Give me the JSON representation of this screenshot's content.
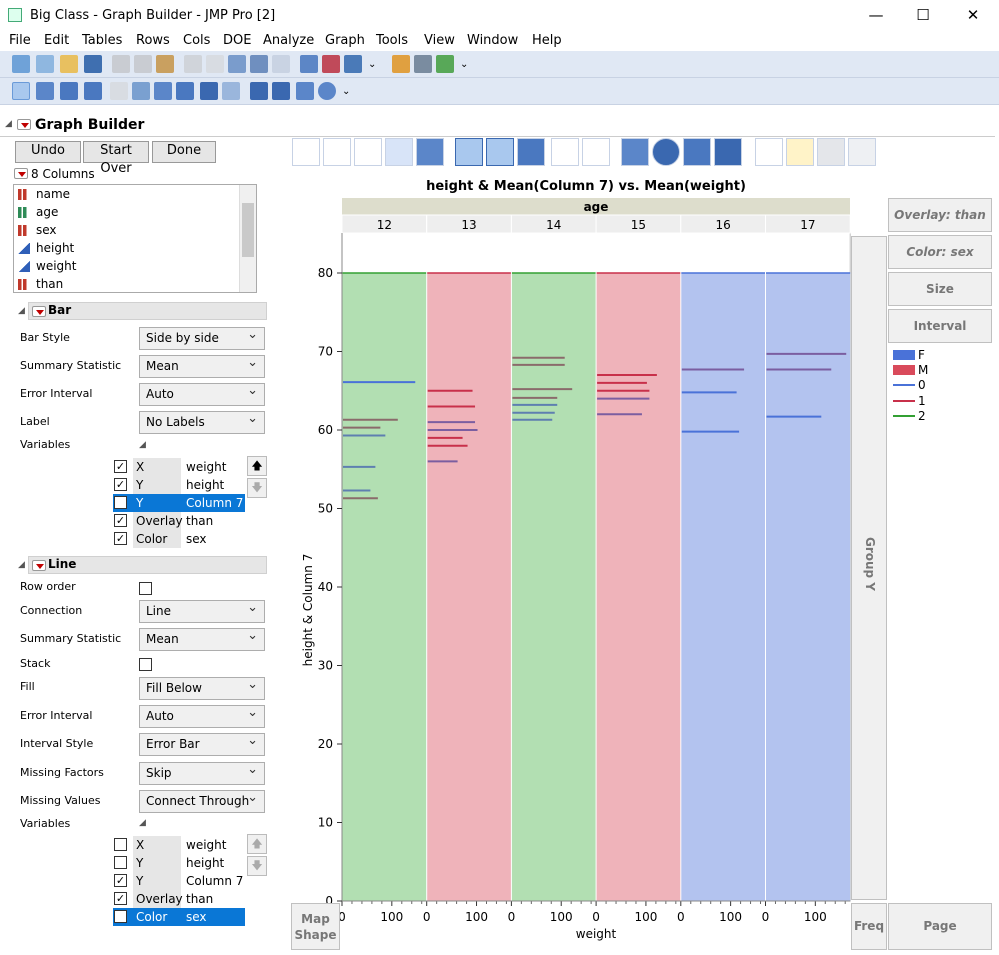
{
  "window": {
    "title": "Big Class - Graph Builder - JMP Pro [2]",
    "minimize": "—",
    "maximize": "☐",
    "close": "✕"
  },
  "menu": [
    "File",
    "Edit",
    "Tables",
    "Rows",
    "Cols",
    "DOE",
    "Analyze",
    "Graph",
    "Tools",
    "View",
    "Window",
    "Help"
  ],
  "panel": {
    "title": "Graph Builder"
  },
  "buttons": {
    "undo": "Undo",
    "start_over": "Start Over",
    "done": "Done"
  },
  "columns": {
    "header": "8 Columns",
    "items": [
      {
        "name": "name",
        "type": "nominal"
      },
      {
        "name": "age",
        "type": "ordinal"
      },
      {
        "name": "sex",
        "type": "nominal"
      },
      {
        "name": "height",
        "type": "continuous"
      },
      {
        "name": "weight",
        "type": "continuous"
      },
      {
        "name": "than",
        "type": "nominal"
      }
    ]
  },
  "bar_section": {
    "title": "Bar",
    "props": [
      {
        "label": "Bar Style",
        "value": "Side by side"
      },
      {
        "label": "Summary Statistic",
        "value": "Mean"
      },
      {
        "label": "Error Interval",
        "value": "Auto"
      },
      {
        "label": "Label",
        "value": "No Labels"
      }
    ],
    "variables_label": "Variables",
    "variables": [
      {
        "checked": true,
        "role": "X",
        "col": "weight",
        "selected": false
      },
      {
        "checked": true,
        "role": "Y",
        "col": "height",
        "selected": false
      },
      {
        "checked": false,
        "role": "Y",
        "col": "Column 7",
        "selected": true
      },
      {
        "checked": true,
        "role": "Overlay",
        "col": "than",
        "selected": false
      },
      {
        "checked": true,
        "role": "Color",
        "col": "sex",
        "selected": false
      }
    ]
  },
  "line_section": {
    "title": "Line",
    "row_order_label": "Row order",
    "row_order_checked": false,
    "connection": {
      "label": "Connection",
      "value": "Line"
    },
    "summary": {
      "label": "Summary Statistic",
      "value": "Mean"
    },
    "stack_label": "Stack",
    "stack_checked": false,
    "props": [
      {
        "label": "Fill",
        "value": "Fill Below"
      },
      {
        "label": "Error Interval",
        "value": "Auto"
      },
      {
        "label": "Interval Style",
        "value": "Error Bar"
      },
      {
        "label": "Missing Factors",
        "value": "Skip"
      },
      {
        "label": "Missing Values",
        "value": "Connect Through"
      }
    ],
    "variables_label": "Variables",
    "variables": [
      {
        "checked": false,
        "role": "X",
        "col": "weight",
        "selected": false
      },
      {
        "checked": false,
        "role": "Y",
        "col": "height",
        "selected": false
      },
      {
        "checked": true,
        "role": "Y",
        "col": "Column 7",
        "selected": false
      },
      {
        "checked": true,
        "role": "Overlay",
        "col": "than",
        "selected": false
      },
      {
        "checked": false,
        "role": "Color",
        "col": "sex",
        "selected": true
      }
    ]
  },
  "drop_zones": {
    "overlay": "Overlay: than",
    "color": "Color: sex",
    "size": "Size",
    "interval": "Interval",
    "group_y": "Group Y",
    "map_shape": "Map Shape",
    "freq": "Freq",
    "page": "Page"
  },
  "legend": [
    {
      "label": "F",
      "kind": "fill",
      "color": "#4a72d8"
    },
    {
      "label": "M",
      "kind": "fill",
      "color": "#d94a5b"
    },
    {
      "label": "0",
      "kind": "line",
      "color": "#4a72d8"
    },
    {
      "label": "1",
      "kind": "line",
      "color": "#c8304a"
    },
    {
      "label": "2",
      "kind": "line",
      "color": "#33a033"
    }
  ],
  "chart_data": {
    "type": "bar",
    "title": "height & Mean(Column 7) vs. Mean(weight)",
    "xlabel": "weight",
    "ylabel": "height & Column 7",
    "group_x_label": "age",
    "ylim": [
      0,
      80
    ],
    "yticks": [
      0,
      10,
      20,
      30,
      40,
      50,
      60,
      70,
      80
    ],
    "xticks": [
      0,
      100
    ],
    "xlim": [
      0,
      170
    ],
    "line_fill_level": 80,
    "panels": [
      {
        "age": "12",
        "fill_sex": "F",
        "fill": "#b2dfb2",
        "topline": "#33a033",
        "bars": [
          {
            "y": 66.1,
            "w": 145,
            "color": "#4a72d8"
          },
          {
            "y": 61.3,
            "w": 110,
            "color": "#8a6b6b"
          },
          {
            "y": 60.3,
            "w": 75,
            "color": "#8a6b6b"
          },
          {
            "y": 59.3,
            "w": 85,
            "color": "#5e7fb0"
          },
          {
            "y": 55.3,
            "w": 65,
            "color": "#5e7fb0"
          },
          {
            "y": 52.3,
            "w": 55,
            "color": "#5e7fb0"
          },
          {
            "y": 51.3,
            "w": 70,
            "color": "#8a6b6b"
          }
        ]
      },
      {
        "age": "13",
        "fill_sex": "M",
        "fill": "#efb3ba",
        "topline": "#c8304a",
        "bars": [
          {
            "y": 65.0,
            "w": 90,
            "color": "#c8304a"
          },
          {
            "y": 63.0,
            "w": 95,
            "color": "#c8304a"
          },
          {
            "y": 61.0,
            "w": 95,
            "color": "#7b5ea0"
          },
          {
            "y": 60.0,
            "w": 100,
            "color": "#7b5ea0"
          },
          {
            "y": 59.0,
            "w": 70,
            "color": "#c8304a"
          },
          {
            "y": 58.0,
            "w": 80,
            "color": "#c8304a"
          },
          {
            "y": 56.0,
            "w": 60,
            "color": "#7b5ea0"
          }
        ]
      },
      {
        "age": "14",
        "fill_sex": "F",
        "fill": "#b2dfb2",
        "topline": "#33a033",
        "bars": [
          {
            "y": 69.2,
            "w": 105,
            "color": "#8a6b6b"
          },
          {
            "y": 68.3,
            "w": 105,
            "color": "#8a6b6b"
          },
          {
            "y": 65.2,
            "w": 120,
            "color": "#8a6b6b"
          },
          {
            "y": 64.1,
            "w": 90,
            "color": "#8a6b6b"
          },
          {
            "y": 63.2,
            "w": 90,
            "color": "#5e7fb0"
          },
          {
            "y": 62.2,
            "w": 85,
            "color": "#5e7fb0"
          },
          {
            "y": 61.3,
            "w": 80,
            "color": "#5e7fb0"
          }
        ]
      },
      {
        "age": "15",
        "fill_sex": "M",
        "fill": "#efb3ba",
        "topline": "#c8304a",
        "bars": [
          {
            "y": 67.0,
            "w": 120,
            "color": "#c8304a"
          },
          {
            "y": 66.0,
            "w": 100,
            "color": "#c8304a"
          },
          {
            "y": 65.0,
            "w": 105,
            "color": "#c8304a"
          },
          {
            "y": 64.0,
            "w": 105,
            "color": "#7b5ea0"
          },
          {
            "y": 62.0,
            "w": 90,
            "color": "#7b5ea0"
          }
        ]
      },
      {
        "age": "16",
        "fill_sex": "M",
        "fill": "#b3c3ef",
        "topline": "#4a72d8",
        "bars": [
          {
            "y": 67.7,
            "w": 125,
            "color": "#7b5ea0"
          },
          {
            "y": 64.8,
            "w": 110,
            "color": "#4a72d8"
          },
          {
            "y": 59.8,
            "w": 115,
            "color": "#4a72d8"
          }
        ]
      },
      {
        "age": "17",
        "fill_sex": "M",
        "fill": "#b3c3ef",
        "topline": "#4a72d8",
        "bars": [
          {
            "y": 69.7,
            "w": 160,
            "color": "#7b5ea0"
          },
          {
            "y": 67.7,
            "w": 130,
            "color": "#7b5ea0"
          },
          {
            "y": 61.7,
            "w": 110,
            "color": "#4a72d8"
          }
        ]
      }
    ]
  }
}
